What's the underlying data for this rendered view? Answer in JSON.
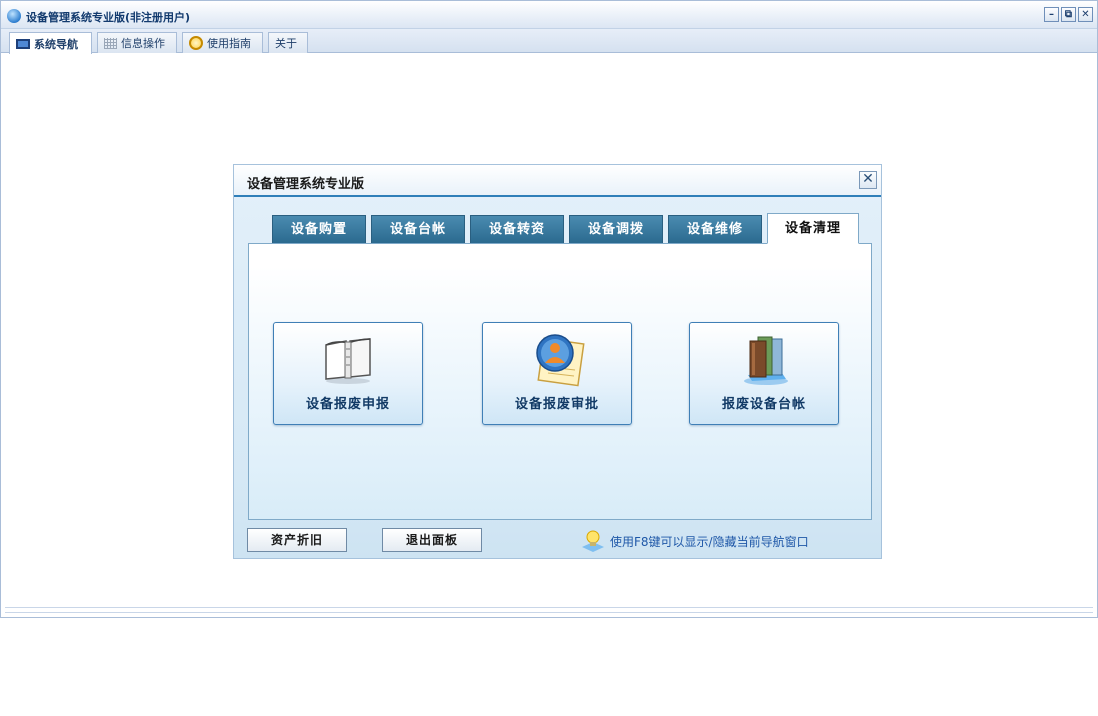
{
  "window": {
    "title": "设备管理系统专业版(非注册用户)",
    "controls": {
      "minimize": "–",
      "restore": "⧉",
      "close": "✕"
    }
  },
  "top_tabs": [
    {
      "label": "系统导航",
      "icon": "monitor-icon",
      "active": true
    },
    {
      "label": "信息操作",
      "icon": "grid-icon",
      "active": false
    },
    {
      "label": "使用指南",
      "icon": "help-icon",
      "active": false
    },
    {
      "label": "关于",
      "icon": "",
      "active": false
    }
  ],
  "dialog": {
    "title": "设备管理系统专业版",
    "close": "✕",
    "tabs": [
      {
        "label": "设备购置",
        "active": false
      },
      {
        "label": "设备台帐",
        "active": false
      },
      {
        "label": "设备转资",
        "active": false
      },
      {
        "label": "设备调拨",
        "active": false
      },
      {
        "label": "设备维修",
        "active": false
      },
      {
        "label": "设备清理",
        "active": true
      }
    ],
    "actions": [
      {
        "label": "设备报废申报",
        "icon": "open-book-icon"
      },
      {
        "label": "设备报废审批",
        "icon": "user-approval-icon"
      },
      {
        "label": "报废设备台帐",
        "icon": "books-icon"
      }
    ],
    "buttons": {
      "depreciation": "资产折旧",
      "exit": "退出面板"
    },
    "tip": "使用F8键可以显示/隐藏当前导航窗口"
  },
  "colors": {
    "tab_blue": "#2b6a8f",
    "accent": "#2f7fb9",
    "tip_text": "#1f58a8"
  }
}
